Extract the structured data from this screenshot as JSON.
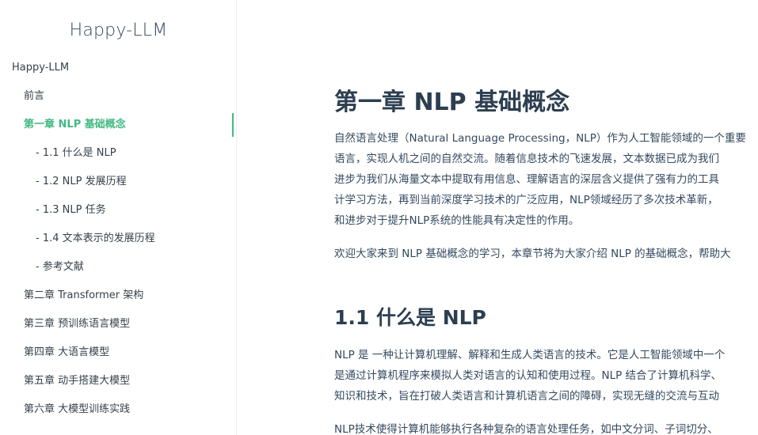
{
  "sidebar": {
    "app_title": "Happy-LLM",
    "items": [
      {
        "label": "Happy-LLM",
        "level": 0
      },
      {
        "label": "前言",
        "level": 1
      },
      {
        "label": "第一章 NLP 基础概念",
        "level": 1,
        "active": true
      },
      {
        "label": "- 1.1 什么是 NLP",
        "level": 2
      },
      {
        "label": "- 1.2 NLP 发展历程",
        "level": 2
      },
      {
        "label": "- 1.3 NLP 任务",
        "level": 2
      },
      {
        "label": "- 1.4 文本表示的发展历程",
        "level": 2
      },
      {
        "label": "- 参考文献",
        "level": 2
      },
      {
        "label": "第二章 Transformer 架构",
        "level": 1
      },
      {
        "label": "第三章 预训练语言模型",
        "level": 1
      },
      {
        "label": "第四章 大语言模型",
        "level": 1
      },
      {
        "label": "第五章 动手搭建大模型",
        "level": 1
      },
      {
        "label": "第六章 大模型训练实践",
        "level": 1
      }
    ]
  },
  "main": {
    "chapter_title": "第一章 NLP 基础概念",
    "intro_lines": [
      "自然语言处理（Natural Language Processing，NLP）作为人工智能领域的一个重要",
      "语言，实现人机之间的自然交流。随着信息技术的飞速发展，文本数据已成为我们",
      "进步为我们从海量文本中提取有用信息、理解语言的深层含义提供了强有力的工具",
      "计学习方法，再到当前深度学习技术的广泛应用，NLP领域经历了多次技术革新，",
      "和进步对于提升NLP系统的性能具有决定性的作用。"
    ],
    "welcome_line": "欢迎大家来到 NLP 基础概念的学习，本章节将为大家介绍 NLP 的基础概念，帮助大",
    "section_title": "1.1 什么是 NLP",
    "section_lines": [
      "NLP 是 一种让计算机理解、解释和生成人类语言的技术。它是人工智能领域中一个",
      "是通过计算机程序来模拟人类对语言的认知和使用过程。NLP 结合了计算机科学、",
      "知识和技术，旨在打破人类语言和计算机语言之间的障碍，实现无缝的交流与互动"
    ],
    "last_line": "NLP技术使得计算机能够执行各种复杂的语言处理任务，如中文分词、子词切分、"
  }
}
